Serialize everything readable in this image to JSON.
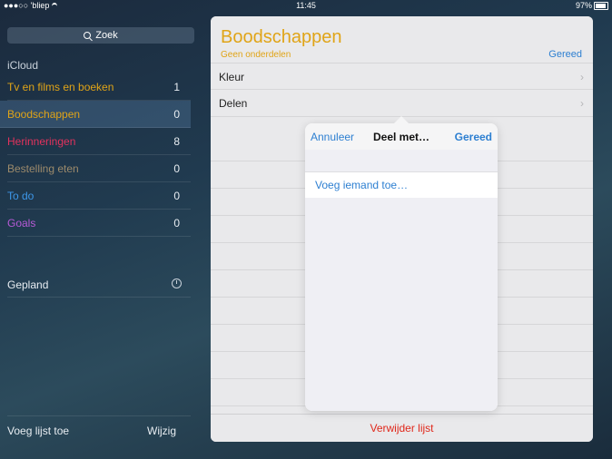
{
  "status_bar": {
    "carrier": "●●●○○ 'bliep",
    "time": "11:45",
    "battery": "97%"
  },
  "sidebar": {
    "search_label": "Zoek",
    "section": "iCloud",
    "lists": [
      {
        "name": "Tv en films en boeken",
        "count": "1",
        "color": "#e0a417"
      },
      {
        "name": "Boodschappen",
        "count": "0",
        "color": "#e0a417"
      },
      {
        "name": "Herinneringen",
        "count": "8",
        "color": "#e2325d"
      },
      {
        "name": "Bestelling eten",
        "count": "0",
        "color": "#9c8a6b"
      },
      {
        "name": "To do",
        "count": "0",
        "color": "#3d97e8"
      },
      {
        "name": "Goals",
        "count": "0",
        "color": "#b65ad6"
      }
    ],
    "planned": "Gepland",
    "add_list": "Voeg lijst toe",
    "edit": "Wijzig"
  },
  "list_panel": {
    "title": "Boodschappen",
    "subtitle": "Geen onderdelen",
    "done": "Gereed",
    "rows": [
      {
        "name": "Kleur"
      },
      {
        "name": "Delen"
      }
    ],
    "delete": "Verwijder lijst"
  },
  "share_popover": {
    "cancel": "Annuleer",
    "title": "Deel met…",
    "done": "Gereed",
    "add_person": "Voeg iemand toe…"
  }
}
